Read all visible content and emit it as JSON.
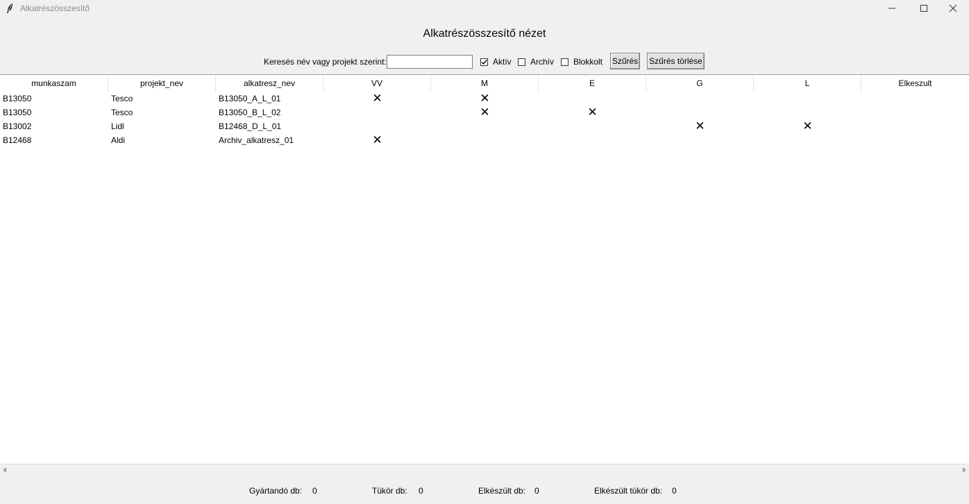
{
  "window": {
    "title": "Alkatrészösszesítő",
    "icon": "feather-icon"
  },
  "heading": "Alkatrészösszesítő nézet",
  "filter": {
    "search_label": "Keresés név vagy projekt szerint:",
    "search_value": "",
    "checkboxes": [
      {
        "label": "Aktív",
        "checked": true
      },
      {
        "label": "Archív",
        "checked": false
      },
      {
        "label": "Blokkolt",
        "checked": false
      }
    ],
    "filter_button": "Szűrés",
    "clear_button": "Szűrés törlése"
  },
  "table": {
    "columns": [
      "munkaszam",
      "projekt_nev",
      "alkatresz_nev",
      "VV",
      "M",
      "E",
      "G",
      "L",
      "Elkeszult"
    ],
    "mark_symbol": "✕",
    "rows": [
      {
        "munkaszam": "B13050",
        "projekt_nev": "Tesco",
        "alkatresz_nev": "B13050_A_L_01",
        "VV": "✕",
        "M": "✕",
        "E": "",
        "G": "",
        "L": "",
        "Elkeszult": ""
      },
      {
        "munkaszam": "B13050",
        "projekt_nev": "Tesco",
        "alkatresz_nev": "B13050_B_L_02",
        "VV": "",
        "M": "✕",
        "E": "✕",
        "G": "",
        "L": "",
        "Elkeszult": ""
      },
      {
        "munkaszam": "B13002",
        "projekt_nev": "Lidl",
        "alkatresz_nev": "B12468_D_L_01",
        "VV": "",
        "M": "",
        "E": "",
        "G": "✕",
        "L": "✕",
        "Elkeszult": ""
      },
      {
        "munkaszam": "B12468",
        "projekt_nev": "Aldi",
        "alkatresz_nev": "Archiv_alkatresz_01",
        "VV": "✕",
        "M": "",
        "E": "",
        "G": "",
        "L": "",
        "Elkeszult": ""
      }
    ]
  },
  "footer": {
    "gyartando_label": "Gyártandó db:",
    "gyartando_value": "0",
    "tukor_label": "Tükör db:",
    "tukor_value": "0",
    "elkeszult_label": "Elkészült db:",
    "elkeszult_value": "0",
    "elkeszult_tukor_label": "Elkészült tükör db:",
    "elkeszult_tukor_value": "0"
  }
}
